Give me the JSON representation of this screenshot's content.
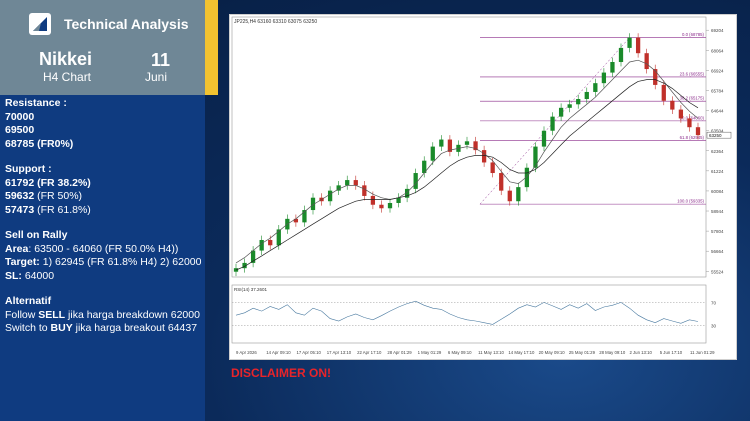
{
  "header": {
    "brand": "Technical Analysis",
    "ticker": "Nikkei",
    "timeframe": "H4 Chart",
    "day": "11",
    "month": "Juni",
    "colors": {
      "panel": "#0f3b80",
      "header": "#6f8796",
      "accent": "#f2c230"
    },
    "logo_icon": "chart-arrow-logo-icon"
  },
  "analysis": {
    "resistance_title": "Resistance :",
    "resistance": [
      "70000",
      "69500",
      "68785 (FR0%)"
    ],
    "support_title": "Support :",
    "support": [
      {
        "value": "61792",
        "note": "(FR 38.2%)",
        "bold_note": true
      },
      {
        "value": "59632",
        "note": "(FR 50%)",
        "bold_note": false
      },
      {
        "value": "57473",
        "note": "(FR 61.8%)",
        "bold_note": false
      }
    ],
    "sell": {
      "title": "Sell on Rally",
      "area_label": "Area",
      "area_value": ": 63500 - 64060 (FR 50.0% H4))",
      "target_label": "Target:",
      "target_value": "1) 62945 (FR 61.8% H4) 2) 62000",
      "sl_label": "SL:",
      "sl_value": "64000"
    },
    "alt": {
      "title": "Alternatif",
      "line1_pre": "Follow ",
      "line1_bold": "SELL",
      "line1_post": " jika harga breakdown 62000",
      "line2_pre": "Switch to ",
      "line2_bold": "BUY",
      "line2_post": " jika harga breakout 64437"
    }
  },
  "disclaimer": "DISCLAIMER ON!",
  "chart_data": {
    "type": "line",
    "title": "JP225,H4 63160 63310 63075 63250",
    "x_ticks": [
      "9 Apr 2026",
      "14 Apr 09:10",
      "17 Apr 05:10",
      "17 Apr 13:10",
      "22 Apr 17:10",
      "28 Apr 01:29",
      "1 May 01:29",
      "6 May 09:10",
      "11 May 13:10",
      "14 May 17:10",
      "20 May 09:10",
      "25 May 01:29",
      "28 May 09:10",
      "2 Jun 13:10",
      "5 Jun 17:10",
      "11 Jun 01:29"
    ],
    "y_ticks": [
      69204,
      68064,
      66924,
      65784,
      64644,
      63504,
      62364,
      61224,
      60084,
      58944,
      57804,
      56664,
      55524
    ],
    "ylim": [
      55200,
      69500
    ],
    "price_label": "63250",
    "fib_levels": [
      {
        "label": "0.0 (68785)",
        "value": 68785
      },
      {
        "label": "23.6 (66555)",
        "value": 66555
      },
      {
        "label": "38.2 (65175)",
        "value": 65175
      },
      {
        "label": "50.0 (64060)",
        "value": 64060
      },
      {
        "label": "61.8 (62945)",
        "value": 62945
      },
      {
        "label": "100.0 (59335)",
        "value": 59335
      }
    ],
    "series": [
      {
        "values": [
          55700,
          56000,
          56700,
          57300,
          57000,
          57900,
          58500,
          58300,
          59000,
          59700,
          59500,
          60100,
          60400,
          60700,
          60400,
          59800,
          59300,
          59100,
          59400,
          59700,
          60200,
          61100,
          61800,
          62600,
          63000,
          62300,
          62700,
          62900,
          62400,
          61700,
          61100,
          60100,
          59500,
          60300,
          61400,
          62600,
          63500,
          64300,
          64800,
          65000,
          65300,
          65700,
          66200,
          66800,
          67400,
          68200,
          68785,
          67900,
          67000,
          66100,
          65200,
          64700,
          64200,
          63700,
          63250
        ]
      }
    ],
    "ma_fast": [
      56000,
      56300,
      56700,
      57100,
      57400,
      57800,
      58200,
      58500,
      58900,
      59300,
      59600,
      59900,
      60200,
      60400,
      60400,
      60200,
      59900,
      59700,
      59600,
      59700,
      60000,
      60500,
      61100,
      61700,
      62200,
      62400,
      62500,
      62600,
      62500,
      62200,
      61800,
      61200,
      60600,
      60500,
      60900,
      61500,
      62300,
      63000,
      63700,
      64200,
      64600,
      65000,
      65400,
      65900,
      66400,
      66900,
      67400,
      67500,
      67300,
      66900,
      66300,
      65700,
      65100,
      64600,
      64200
    ],
    "ma_slow": [
      55600,
      55800,
      56100,
      56400,
      56700,
      57000,
      57300,
      57600,
      57900,
      58200,
      58500,
      58800,
      59100,
      59300,
      59500,
      59600,
      59600,
      59600,
      59600,
      59700,
      59800,
      60000,
      60300,
      60700,
      61100,
      61500,
      61800,
      62000,
      62100,
      62100,
      62000,
      61700,
      61300,
      61100,
      61100,
      61300,
      61700,
      62200,
      62700,
      63200,
      63600,
      64000,
      64400,
      64800,
      65200,
      65600,
      66000,
      66300,
      66400,
      66400,
      66200,
      65900,
      65500,
      65100,
      64800
    ],
    "rsi": {
      "label": "RSI(14) 37.2601",
      "ylim": [
        0,
        100
      ],
      "levels": [
        70,
        30
      ],
      "values": [
        48,
        52,
        60,
        55,
        63,
        58,
        66,
        52,
        48,
        60,
        55,
        42,
        38,
        45,
        50,
        44,
        40,
        47,
        55,
        62,
        68,
        72,
        65,
        60,
        58,
        50,
        44,
        40,
        38,
        35,
        32,
        41,
        50,
        60,
        66,
        62,
        70,
        64,
        58,
        66,
        60,
        68,
        56,
        62,
        65,
        70,
        60,
        48,
        40,
        35,
        42,
        38,
        34,
        40,
        37
      ]
    }
  }
}
